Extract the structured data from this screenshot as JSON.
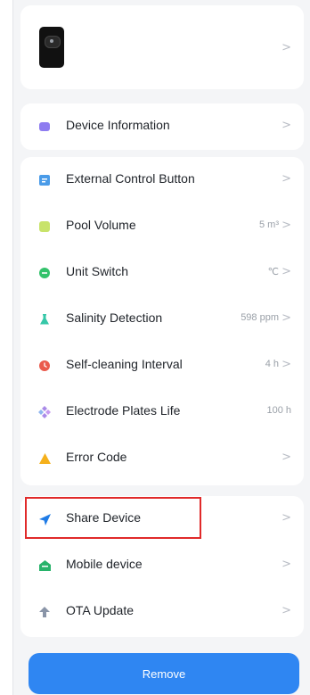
{
  "device_card": {
    "device_icon": "device-thumbnail",
    "chevron": ">"
  },
  "info_section": {
    "items": [
      {
        "label": "Device Information",
        "icon": "info-icon",
        "color": "#8e7cf0",
        "chevron": ">"
      }
    ]
  },
  "settings_section": {
    "items": [
      {
        "label": "External Control Button",
        "icon": "control-icon",
        "color": "#4a9be8",
        "value": "",
        "chevron": ">"
      },
      {
        "label": "Pool Volume",
        "icon": "volume-icon",
        "color": "#c8e36a",
        "value": "5 m³",
        "chevron": ">"
      },
      {
        "label": "Unit Switch",
        "icon": "unit-icon",
        "color": "#33c26b",
        "value": "℃",
        "chevron": ">"
      },
      {
        "label": "Salinity Detection",
        "icon": "flask-icon",
        "color": "#36c7a8",
        "value": "598 ppm",
        "chevron": ">"
      },
      {
        "label": "Self-cleaning Interval",
        "icon": "clock-icon",
        "color": "#ea5b4d",
        "value": "4 h",
        "chevron": ">"
      },
      {
        "label": "Electrode Plates Life",
        "icon": "plates-icon",
        "color": "#a98ae8",
        "value": "100 h",
        "chevron": ""
      },
      {
        "label": "Error Code",
        "icon": "warning-icon",
        "color": "#f5b01b",
        "value": "",
        "chevron": ">"
      }
    ]
  },
  "share_section": {
    "items": [
      {
        "label": "Share Device",
        "icon": "share-icon",
        "color": "#1f7be6",
        "chevron": ">"
      },
      {
        "label": "Mobile device",
        "icon": "mobile-icon",
        "color": "#27b36a",
        "chevron": ">"
      },
      {
        "label": "OTA Update",
        "icon": "update-icon",
        "color": "#8a95a8",
        "chevron": ">"
      }
    ]
  },
  "remove_button": {
    "label": "Remove",
    "color": "#2f86f2"
  },
  "highlight_color": "#e02a2a"
}
